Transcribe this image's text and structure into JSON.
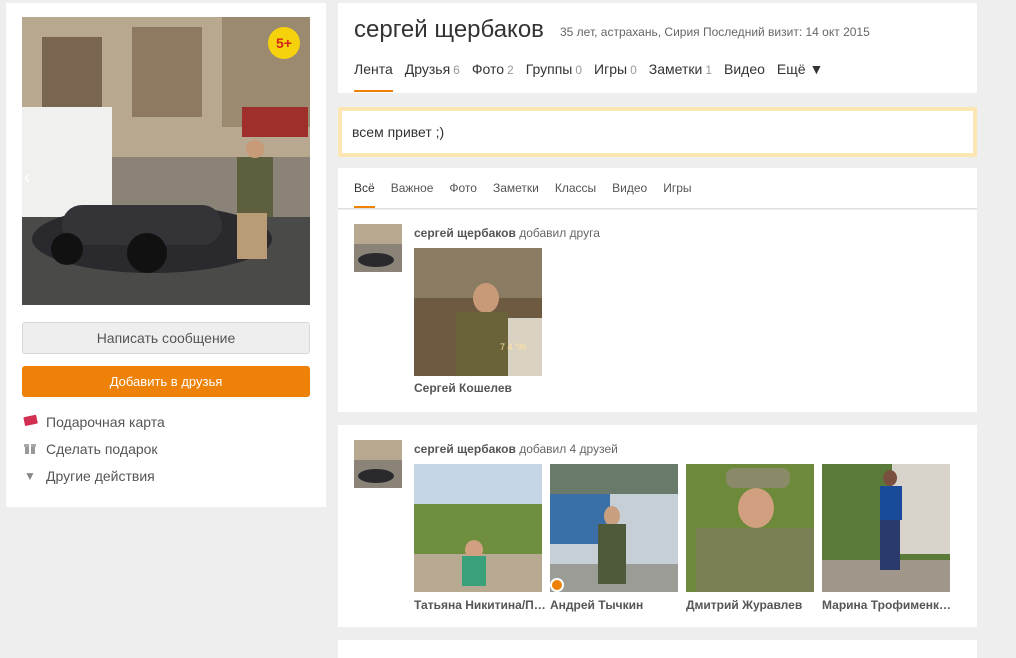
{
  "profile": {
    "name": "сергей щербаков",
    "meta": "35 лет, астрахань, Сирия Последний визит: 14 окт 2015",
    "badge": "5+",
    "send_message": "Написать сообщение",
    "add_friend": "Добавить в друзья",
    "actions": [
      {
        "label": "Подарочная карта",
        "icon": "gift-card-icon"
      },
      {
        "label": "Сделать подарок",
        "icon": "gift-icon"
      },
      {
        "label": "Другие действия",
        "icon": "triangle-down-icon"
      }
    ]
  },
  "tabs": [
    {
      "label": "Лента",
      "count": ""
    },
    {
      "label": "Друзья",
      "count": "6"
    },
    {
      "label": "Фото",
      "count": "2"
    },
    {
      "label": "Группы",
      "count": "0"
    },
    {
      "label": "Игры",
      "count": "0"
    },
    {
      "label": "Заметки",
      "count": "1"
    },
    {
      "label": "Видео",
      "count": ""
    },
    {
      "label": "Ещё ▼",
      "count": ""
    }
  ],
  "status": "всем привет ;)",
  "feed_filters": [
    "Всё",
    "Важное",
    "Фото",
    "Заметки",
    "Классы",
    "Видео",
    "Игры"
  ],
  "posts": [
    {
      "author": "сергей щербаков",
      "action": "добавил друга",
      "friends": [
        {
          "name": "Сергей Кошелев",
          "photo_stamp": "7 4 '96"
        }
      ]
    },
    {
      "author": "сергей щербаков",
      "action": "добавил 4 друзей",
      "friends": [
        {
          "name": "Татьяна Никитина/П…"
        },
        {
          "name": "Андрей Тычкин"
        },
        {
          "name": "Дмитрий Журавлев"
        },
        {
          "name": "Марина Трофименк…"
        }
      ]
    }
  ],
  "colors": {
    "accent": "#ee8208",
    "status_border": "#fce6b4",
    "badge": "#f5d20b"
  }
}
